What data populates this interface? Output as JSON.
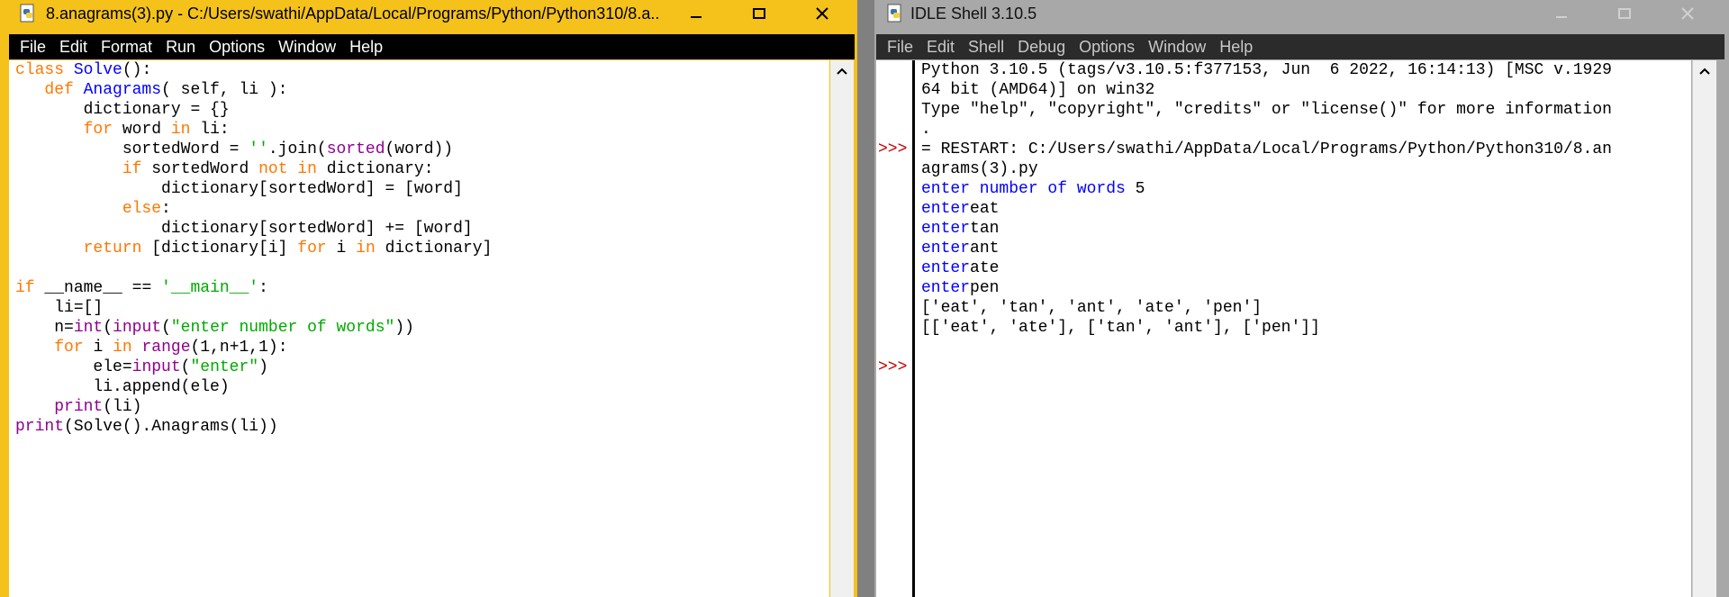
{
  "editor": {
    "title": "8.anagrams(3).py - C:/Users/swathi/AppData/Local/Programs/Python/Python310/8.a...",
    "menu": [
      "File",
      "Edit",
      "Format",
      "Run",
      "Options",
      "Window",
      "Help"
    ],
    "code": {
      "l1_kw": "class",
      "l1_name": "Solve",
      "l1_rest": "():",
      "l2_kw": "def",
      "l2_name": "Anagrams",
      "l2_rest": "( self, li ):",
      "l3": "dictionary = {}",
      "l4_kw": "for",
      "l4_a": "word",
      "l4_kw2": "in",
      "l4_b": "li:",
      "l5_a": "sortedWord = ",
      "l5_str": "''",
      "l5_b": ".join(",
      "l5_bi": "sorted",
      "l5_c": "(word))",
      "l6_kw": "if",
      "l6_a": "sortedWord",
      "l6_kw2": "not in",
      "l6_b": "dictionary:",
      "l7": "dictionary[sortedWord] = [word]",
      "l8_kw": "else",
      "l9": "dictionary[sortedWord] += [word]",
      "l10_kw": "return",
      "l10_a": "[dictionary[i]",
      "l10_kw2": "for",
      "l10_b": "i",
      "l10_kw3": "in",
      "l10_c": "dictionary]",
      "l12_kw": "if",
      "l12_a": "__name__ == ",
      "l12_str": "'__main__'",
      "l12_b": ":",
      "l13": "li=[]",
      "l14_a": "n=",
      "l14_bi": "int",
      "l14_b": "(",
      "l14_bi2": "input",
      "l14_c": "(",
      "l14_str": "\"enter number of words\"",
      "l14_d": "))",
      "l15_kw": "for",
      "l15_a": "i",
      "l15_kw2": "in",
      "l15_bi": "range",
      "l15_b": "(1,n+1,1):",
      "l16_a": "ele=",
      "l16_bi": "input",
      "l16_b": "(",
      "l16_str": "\"enter\"",
      "l16_c": ")",
      "l17": "li.append(ele)",
      "l18_bi": "print",
      "l18_a": "(li)",
      "l19_bi": "print",
      "l19_a": "(Solve().Anagrams(li))"
    }
  },
  "shell": {
    "title": "IDLE Shell 3.10.5",
    "menu": [
      "File",
      "Edit",
      "Shell",
      "Debug",
      "Options",
      "Window",
      "Help"
    ],
    "prompt": ">>>",
    "lines": {
      "banner1": "Python 3.10.5 (tags/v3.10.5:f377153, Jun  6 2022, 16:14:13) [MSC v.1929",
      "banner2": "64 bit (AMD64)] on win32",
      "banner3": "Type \"help\", \"copyright\", \"credits\" or \"license()\" for more information",
      "banner4": ".",
      "restart1": "= RESTART: C:/Users/swathi/AppData/Local/Programs/Python/Python310/8.an",
      "restart2": "agrams(3).py",
      "prompt_words": "enter number of words ",
      "ans_words": "5",
      "enter_label": "enter",
      "inputs": [
        "eat",
        "tan",
        "ant",
        "ate",
        "pen"
      ],
      "out1": "['eat', 'tan', 'ant', 'ate', 'pen']",
      "out2": "[['eat', 'ate'], ['tan', 'ant'], ['pen']]"
    }
  },
  "colors": {
    "editor_frame": "#f4c21b",
    "shell_frame": "#a8a8a8",
    "keyword": "#ff7700",
    "builtin": "#900090",
    "definition": "#0000ff",
    "string": "#00aa00",
    "stdout": "#0000ff",
    "prompt": "#c00000"
  },
  "icons": [
    "python-file-icon",
    "minimize-icon",
    "maximize-icon",
    "close-icon",
    "scroll-up-arrow-icon"
  ]
}
